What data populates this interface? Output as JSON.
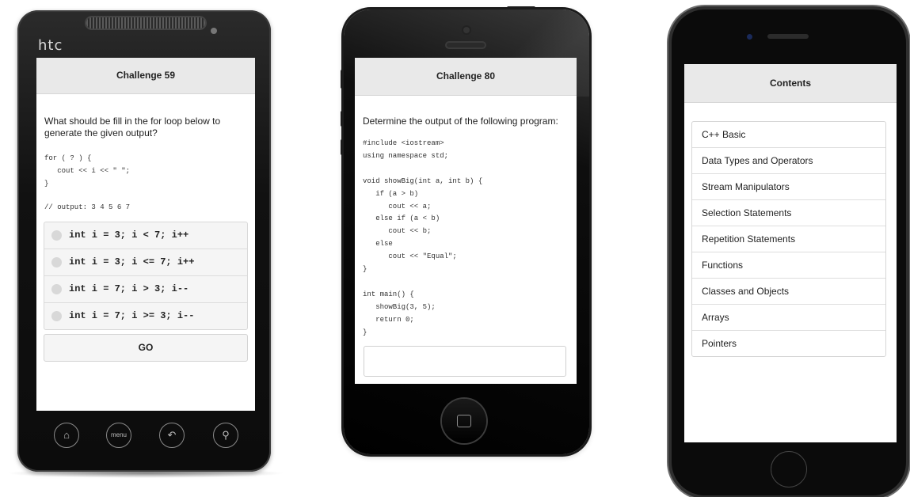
{
  "phone1": {
    "brand": "htc",
    "header_title": "Challenge 59",
    "question": "What should be fill in the for loop below to generate the given output?",
    "code": "for ( ? ) {\n   cout << i << \" \";\n}",
    "output_comment": "// output: 3 4 5 6 7",
    "options": [
      "int i = 3; i < 7; i++",
      "int i = 3; i <= 7; i++",
      "int i = 7; i > 3; i--",
      "int i = 7; i >= 3; i--"
    ],
    "go_label": "GO",
    "nav_buttons": [
      {
        "icon": "home-icon",
        "glyph": "⌂"
      },
      {
        "icon": "menu-icon",
        "glyph": "menu"
      },
      {
        "icon": "back-icon",
        "glyph": "↶"
      },
      {
        "icon": "search-icon",
        "glyph": "⚲"
      }
    ]
  },
  "phone2": {
    "header_title": "Challenge 80",
    "question": "Determine the output of the following program:",
    "code": "#include <iostream>\nusing namespace std;\n\nvoid showBig(int a, int b) {\n   if (a > b)\n      cout << a;\n   else if (a < b)\n      cout << b;\n   else\n      cout << \"Equal\";\n}\n\nint main() {\n   showBig(3, 5);\n   return 0;\n}",
    "answer_value": ""
  },
  "phone3": {
    "header_title": "Contents",
    "items": [
      "C++ Basic",
      "Data Types and Operators",
      "Stream Manipulators",
      "Selection Statements",
      "Repetition Statements",
      "Functions",
      "Classes and Objects",
      "Arrays",
      "Pointers"
    ]
  }
}
